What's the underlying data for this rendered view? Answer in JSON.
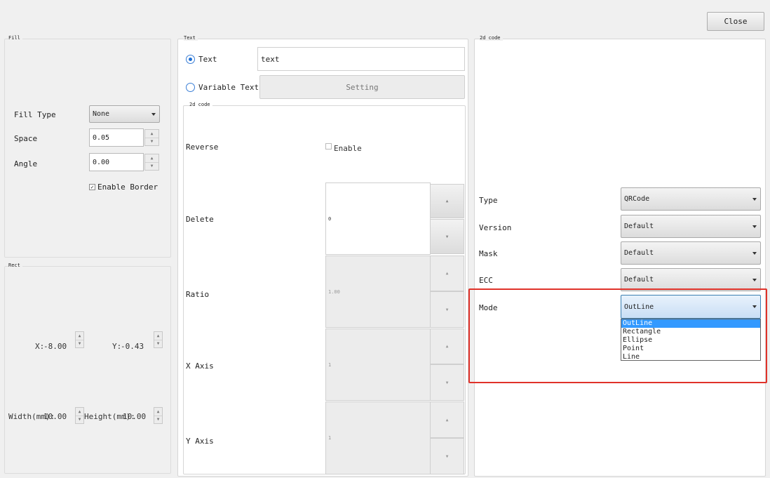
{
  "toolbar": {
    "close_label": "Close"
  },
  "fill": {
    "title": "Fill",
    "fill_type_label": "Fill Type",
    "fill_type_value": "None",
    "space_label": "Space",
    "space_value": "0.05",
    "angle_label": "Angle",
    "angle_value": "0.00",
    "enable_border_label": "Enable Border",
    "enable_border_checked": true
  },
  "rect": {
    "title": "Rect",
    "x_label": "X:",
    "x_value": "-8.00",
    "y_label": "Y:",
    "y_value": "-0.43",
    "width_label": "Width(mm):",
    "width_value": "10.00",
    "height_label": "Height(mm):",
    "height_value": "10.00"
  },
  "text_group": {
    "title": "Text",
    "text_radio_label": "Text",
    "text_value": "text",
    "variable_text_label": "Variable Text",
    "setting_label": "Setting",
    "selected": "Text"
  },
  "code_sub": {
    "title": "2d code",
    "reverse_label": "Reverse",
    "reverse_enable_label": "Enable",
    "delete_label": "Delete",
    "delete_value": "0",
    "ratio_label": "Ratio",
    "ratio_value": "1.00",
    "x_axis_label": "X Axis",
    "x_axis_value": "1",
    "y_axis_label": "Y Axis",
    "y_axis_value": "1"
  },
  "code_right": {
    "title": "2d code",
    "type_label": "Type",
    "type_value": "QRCode",
    "version_label": "Version",
    "version_value": "Default",
    "mask_label": "Mask",
    "mask_value": "Default",
    "ecc_label": "ECC",
    "ecc_value": "Default",
    "mode_label": "Mode",
    "mode_value": "OutLine",
    "mode_options": [
      "OutLine",
      "Rectangle",
      "Ellipse",
      "Point",
      "Line"
    ],
    "mode_selected_index": 0
  },
  "colors": {
    "highlight": "#e0322a",
    "selection": "#3399ff",
    "radio_accent": "#1f6fd4"
  }
}
